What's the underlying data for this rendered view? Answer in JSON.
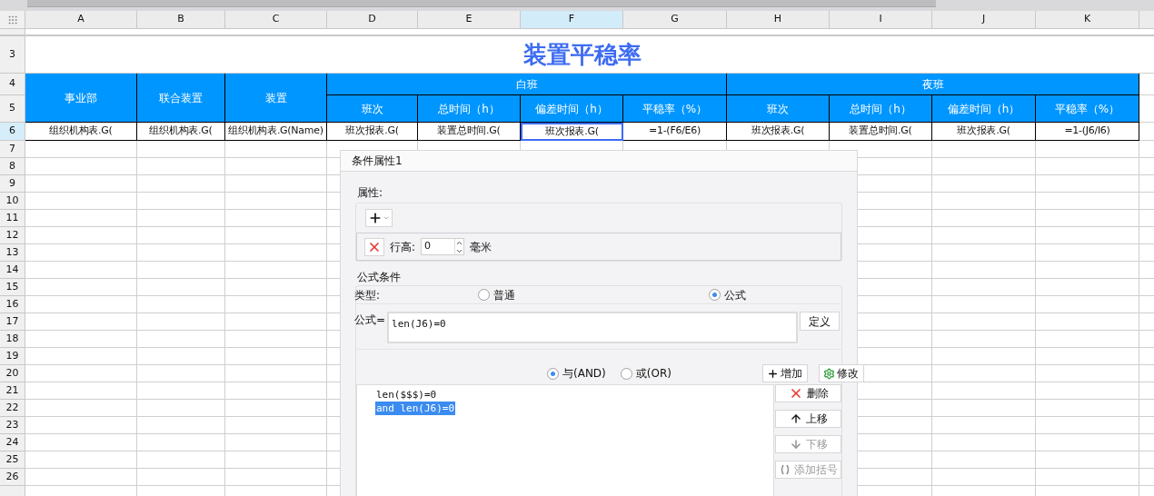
{
  "sheet": {
    "columns": [
      {
        "label": "A",
        "selected": false
      },
      {
        "label": "B",
        "selected": false
      },
      {
        "label": "C",
        "selected": false
      },
      {
        "label": "D",
        "selected": false
      },
      {
        "label": "E",
        "selected": false
      },
      {
        "label": "F",
        "selected": true
      },
      {
        "label": "G",
        "selected": false
      },
      {
        "label": "H",
        "selected": false
      },
      {
        "label": "I",
        "selected": false
      },
      {
        "label": "J",
        "selected": false
      },
      {
        "label": "K",
        "selected": false
      }
    ],
    "title_row": "3",
    "title": "装置平稳率",
    "header_rows": [
      "4",
      "5"
    ],
    "fixed_headers": [
      "事业部",
      "联合装置",
      "装置"
    ],
    "groups": [
      {
        "label": "白班",
        "subheaders": [
          "班次",
          "总时间（h）",
          "偏差时间（h）",
          "平稳率（%）"
        ]
      },
      {
        "label": "夜班",
        "subheaders": [
          "班次",
          "总时间（h）",
          "偏差时间（h）",
          "平稳率（%）"
        ]
      }
    ],
    "data_row": {
      "label": "6",
      "selected": true,
      "cells": [
        {
          "text": "组织机构表.G(",
          "selected": false
        },
        {
          "text": "组织机构表.G(",
          "selected": false
        },
        {
          "text": "组织机构表.G(Name)",
          "selected": false
        },
        {
          "text": "班次报表.G(",
          "selected": false
        },
        {
          "text": "装置总时间.G(",
          "selected": false
        },
        {
          "text": "班次报表.G(",
          "selected": true
        },
        {
          "text": "=1-(F6/E6)",
          "selected": false
        },
        {
          "text": "班次报表.G(",
          "selected": false
        },
        {
          "text": "装置总时间.G(",
          "selected": false
        },
        {
          "text": "班次报表.G(",
          "selected": false
        },
        {
          "text": "=1-(J6/I6)",
          "selected": false
        }
      ]
    },
    "empty_rows": [
      "7",
      "8",
      "9",
      "10",
      "11",
      "12",
      "13",
      "14",
      "15",
      "16",
      "17",
      "18",
      "19",
      "20",
      "21",
      "22",
      "23",
      "24",
      "25",
      "26"
    ]
  },
  "dialog": {
    "title": "条件属性1",
    "attributes": {
      "label": "属性:",
      "property": {
        "label": "行高:",
        "value": "0",
        "unit": "毫米"
      }
    },
    "formula_condition": {
      "label": "公式条件",
      "type_label": "类型:",
      "types": [
        {
          "label": "普通",
          "selected": false
        },
        {
          "label": "公式",
          "selected": true
        }
      ],
      "formula_label": "公式=",
      "formula": "len(J6)=0",
      "define_button": "定义",
      "logic": [
        {
          "label": "与(AND)",
          "selected": true
        },
        {
          "label": "或(OR)",
          "selected": false
        }
      ],
      "add_button": "增加",
      "modify_button": "修改",
      "conditions": [
        {
          "text": "len($$$)=0",
          "selected": false
        },
        {
          "text": "and len(J6)=0",
          "selected": true
        }
      ],
      "side_buttons": [
        {
          "kind": "delete",
          "label": "删除",
          "disabled": false
        },
        {
          "kind": "up",
          "label": "上移",
          "disabled": false
        },
        {
          "kind": "down",
          "label": "下移",
          "disabled": true
        },
        {
          "kind": "bracket",
          "label": "添加括号",
          "disabled": true
        }
      ]
    }
  }
}
